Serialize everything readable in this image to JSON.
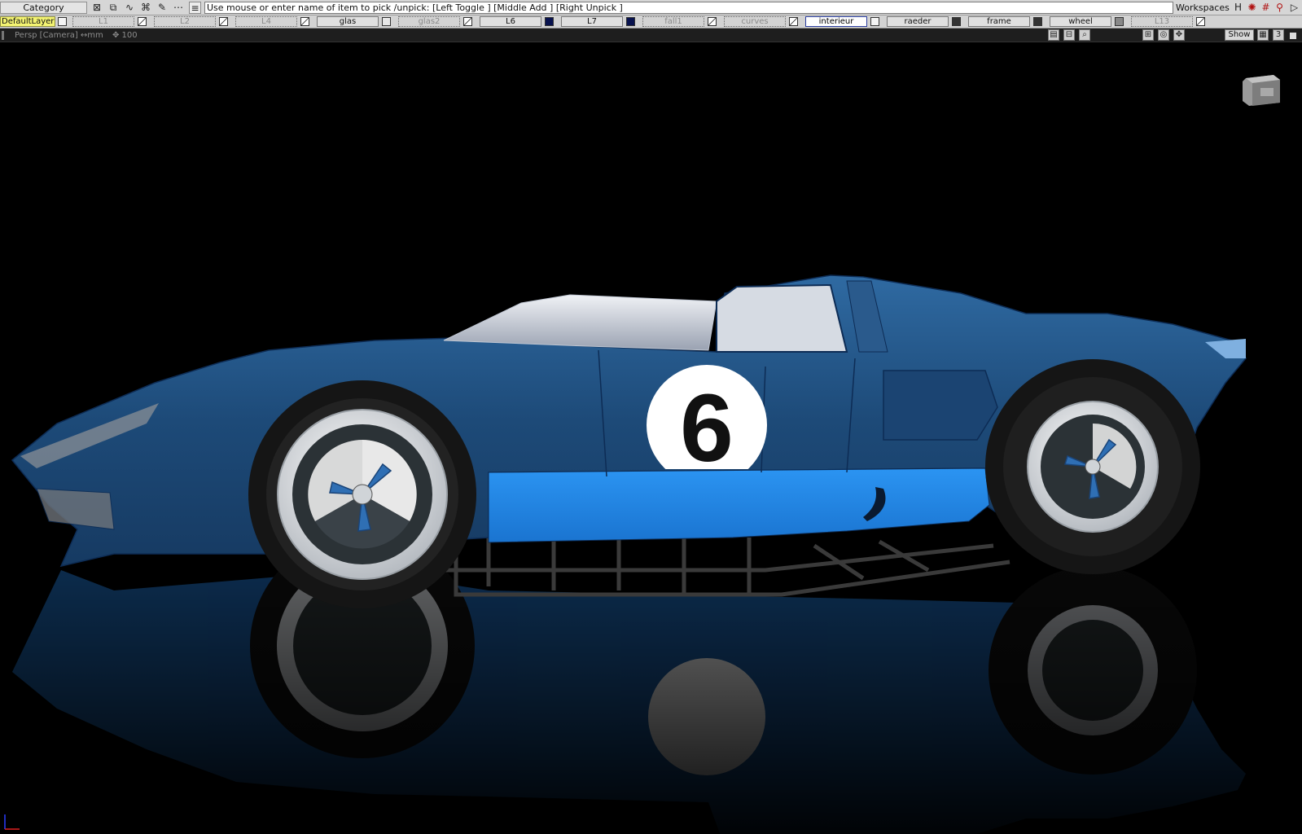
{
  "toolbar": {
    "category_label": "Category",
    "prompt_text": "Use mouse or enter name of item to pick /unpick: [Left Toggle ] [Middle Add ] [Right Unpick ]",
    "workspaces_label": "Workspaces",
    "icons": [
      "select-box-icon",
      "pick-object-icon",
      "curve-icon",
      "surface-icon",
      "pencil-icon",
      "more-icon",
      "list-icon"
    ]
  },
  "layers": {
    "default_layer": "DefaultLayer",
    "items": [
      {
        "label": "L1",
        "state": "hidden",
        "swatch": "slash"
      },
      {
        "label": "L2",
        "state": "hidden",
        "swatch": "slash"
      },
      {
        "label": "L4",
        "state": "hidden",
        "swatch": "slash"
      },
      {
        "label": "glas",
        "state": "visible",
        "swatch": "#e8e8e8"
      },
      {
        "label": "glas2",
        "state": "hidden",
        "swatch": "slash"
      },
      {
        "label": "L6",
        "state": "visible",
        "swatch": "#08124e"
      },
      {
        "label": "L7",
        "state": "visible",
        "swatch": "#08124e"
      },
      {
        "label": "fall1",
        "state": "hidden",
        "swatch": "slash"
      },
      {
        "label": "curves",
        "state": "hidden",
        "swatch": "slash"
      },
      {
        "label": "interieur",
        "state": "active",
        "swatch": "#f4f4f4"
      },
      {
        "label": "raeder",
        "state": "visible",
        "swatch": "#333333"
      },
      {
        "label": "frame",
        "state": "visible",
        "swatch": "#333333"
      },
      {
        "label": "wheel",
        "state": "visible",
        "swatch": "#888888"
      },
      {
        "label": "L13",
        "state": "hidden",
        "swatch": "slash"
      }
    ]
  },
  "viewbar": {
    "camera_label": "Persp [Camera] ↔mm",
    "zoom_label": "✥ 100",
    "show_label": "Show",
    "page_number": "3"
  },
  "scene": {
    "race_number": "6",
    "colors": {
      "body_dark": "#1d4a78",
      "body_stripe": "#1e86e8",
      "roundel": "#ffffff",
      "number": "#111111",
      "tire": "#151515",
      "rim": "#d9dde0",
      "hub": "#2f6fb4",
      "background": "#000000"
    }
  }
}
